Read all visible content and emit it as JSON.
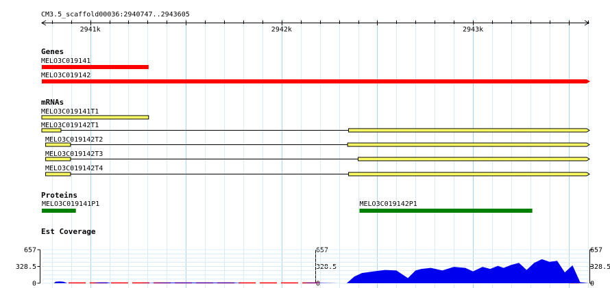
{
  "ruler": {
    "region_label": "CM3.5_scaffold00036:2940747..2943605",
    "ticks": [
      {
        "label": "2941k",
        "pos": 2941000
      },
      {
        "label": "2942k",
        "pos": 2942000
      },
      {
        "label": "2943k",
        "pos": 2943000
      }
    ],
    "start": 2940747,
    "end": 2943605
  },
  "colors": {
    "gene": "#ff0000",
    "mrna_fill": "#ffff66",
    "protein": "#008000",
    "coverage": "#0000ee",
    "coverage_zero": "#ff0000",
    "grid_major": "#a8d4f0",
    "grid_minor": "#d8ecf8"
  },
  "tracks": {
    "genes": {
      "title": "Genes",
      "items": [
        {
          "name": "MELO3C019141",
          "start": 2940747,
          "end": 2941305
        },
        {
          "name": "MELO3C019142",
          "start": 2940747,
          "end": 2943605
        }
      ]
    },
    "mrnas": {
      "title": "mRNAs",
      "items": [
        {
          "name": "MELO3C019141T1",
          "start": 2940747,
          "end": 2941305,
          "exons": [
            [
              2940747,
              2941305
            ]
          ]
        },
        {
          "name": "MELO3C019142T1",
          "start": 2940747,
          "end": 2943605,
          "exons": [
            [
              2940747,
              2940847
            ],
            [
              2942350,
              2943605
            ]
          ]
        },
        {
          "name": "MELO3C019142T2",
          "start": 2940767,
          "end": 2943605,
          "exons": [
            [
              2940767,
              2940897
            ],
            [
              2942345,
              2943605
            ]
          ]
        },
        {
          "name": "MELO3C019142T3",
          "start": 2940767,
          "end": 2943605,
          "exons": [
            [
              2940767,
              2940897
            ],
            [
              2942400,
              2943605
            ]
          ]
        },
        {
          "name": "MELO3C019142T4",
          "start": 2940767,
          "end": 2943605,
          "exons": [
            [
              2940767,
              2940897
            ],
            [
              2942350,
              2943605
            ]
          ]
        }
      ]
    },
    "proteins": {
      "title": "Proteins",
      "items": [
        {
          "name": "MELO3C019141P1",
          "start": 2940747,
          "end": 2940925
        },
        {
          "name": "MELO3C019142P1",
          "start": 2942407,
          "end": 2943310
        }
      ]
    },
    "coverage": {
      "title": "Est Coverage",
      "axis_labels": [
        "657",
        "328.5",
        "0"
      ],
      "max": 657
    }
  },
  "chart_data": {
    "type": "area",
    "title": "Est Coverage",
    "xlabel": "",
    "ylabel": "",
    "ylim": [
      0,
      657
    ],
    "x": [
      2940747,
      2940810,
      2940820,
      2940840,
      2940860,
      2940880,
      2941010,
      2941050,
      2941090,
      2941110,
      2941250,
      2941400,
      2941750,
      2941800,
      2942100,
      2942150,
      2942300,
      2942340,
      2942380,
      2942420,
      2942480,
      2942540,
      2942600,
      2942660,
      2942700,
      2942730,
      2942780,
      2942840,
      2942900,
      2942960,
      2943000,
      2943050,
      2943090,
      2943130,
      2943160,
      2943200,
      2943240,
      2943280,
      2943320,
      2943360,
      2943400,
      2943440,
      2943480,
      2943520,
      2943560,
      2943605
    ],
    "series": [
      {
        "values": [
          0,
          0,
          30,
          35,
          30,
          0,
          0,
          15,
          15,
          0,
          0,
          12,
          12,
          0,
          0,
          10,
          0,
          0,
          130,
          200,
          230,
          260,
          250,
          100,
          250,
          280,
          300,
          250,
          320,
          300,
          230,
          320,
          280,
          340,
          300,
          360,
          400,
          260,
          400,
          470,
          420,
          440,
          210,
          350,
          20,
          0
        ]
      }
    ]
  }
}
